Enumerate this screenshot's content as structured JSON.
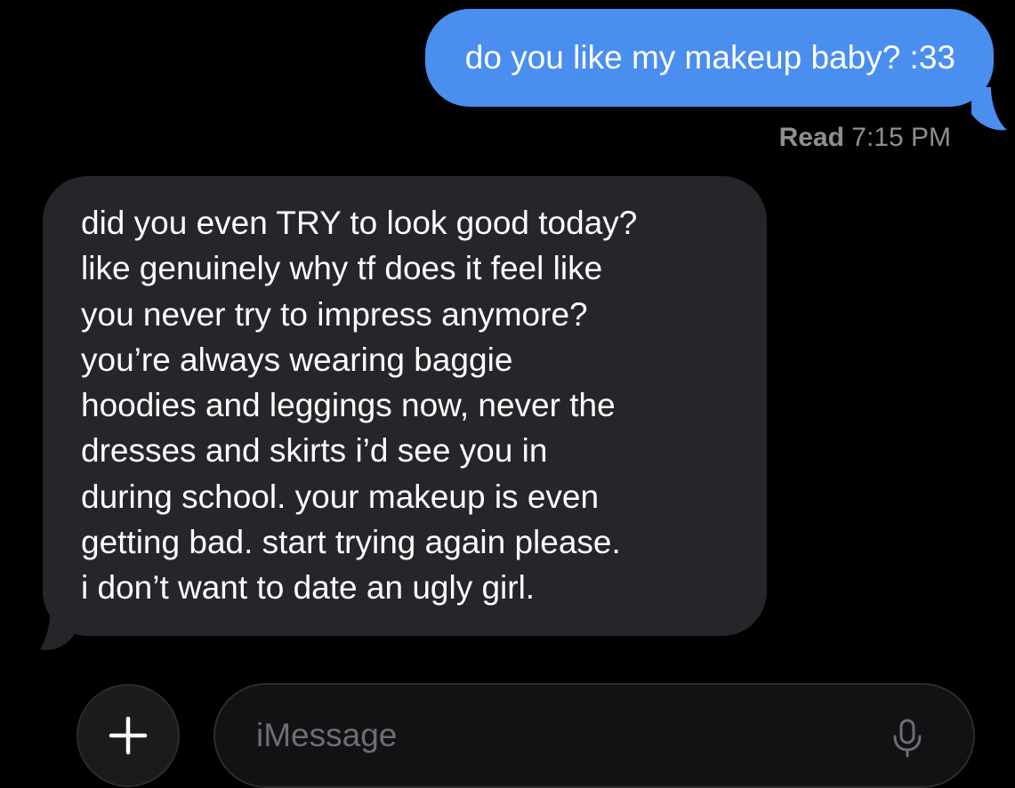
{
  "messages": {
    "sent": {
      "text": "do you like my makeup baby? :33",
      "color": "#4a8ef0"
    },
    "receipt": {
      "status": "Read",
      "time": "7:15 PM"
    },
    "received": {
      "color": "#26252a",
      "lines": [
        "did you even TRY to look good today?",
        "like genuinely why tf does it feel like",
        "you never try to impress anymore?",
        "you’re always wearing baggie",
        "hoodies and leggings now, never the",
        "dresses and skirts i’d see you in",
        "during school. your makeup is even",
        "getting bad. start trying again please.",
        "i don’t want to date an ugly girl."
      ]
    }
  },
  "composer": {
    "plus_icon": "plus-icon",
    "placeholder": "iMessage",
    "value": "",
    "mic_icon": "microphone-icon"
  },
  "colors": {
    "background": "#000000",
    "sent_bubble": "#4a8ef0",
    "received_bubble": "#26252a",
    "meta_text": "#8e8e93",
    "placeholder_text": "#6d6d72"
  }
}
